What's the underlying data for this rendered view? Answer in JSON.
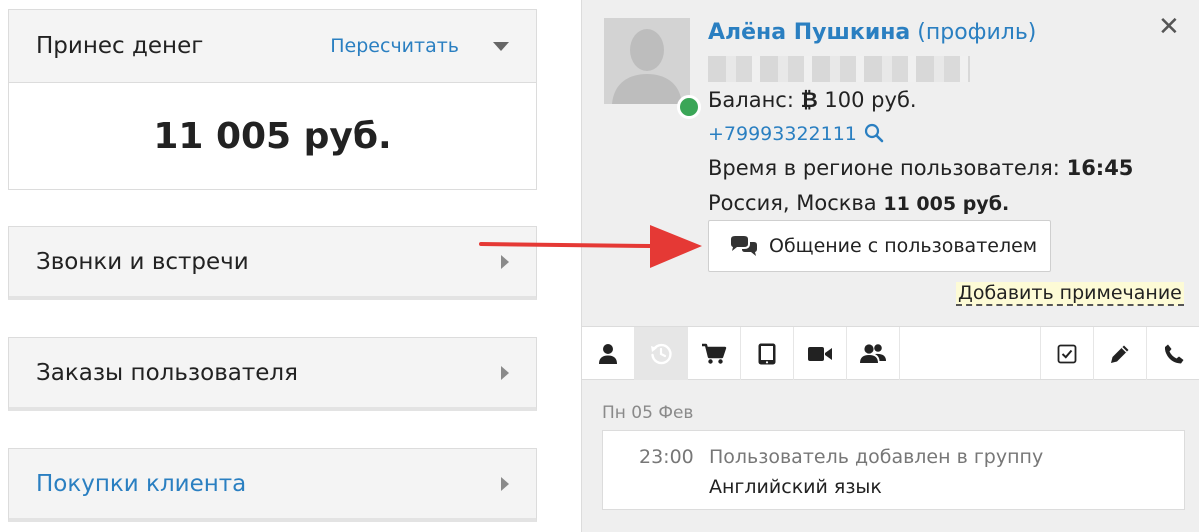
{
  "left": {
    "money_card": {
      "title": "Принес денег",
      "recalc_label": "Пересчитать",
      "amount": "11 005 руб."
    },
    "sections": [
      {
        "label": "Звонки и встречи"
      },
      {
        "label": "Заказы пользователя"
      },
      {
        "label": "Покупки клиента"
      }
    ]
  },
  "panel": {
    "close_icon": "close-icon",
    "user": {
      "name": "Алёна Пушкина",
      "profile_link": "(профиль)",
      "online_color": "#3aa657"
    },
    "balance": {
      "label": "Баланс:",
      "currency_icon": "bitcoin-icon",
      "value": "100 руб."
    },
    "phone": "+79993322111",
    "region_time": {
      "label": "Время в регионе пользователя:",
      "value": "16:45"
    },
    "location": {
      "text": "Россия, Москва",
      "amount": "11 005 руб."
    },
    "chat_button_label": "Общение с пользователем",
    "add_note_label": "Добавить примечание",
    "tabs": [
      {
        "icon": "user-icon",
        "active": false
      },
      {
        "icon": "history-icon",
        "active": true
      },
      {
        "icon": "cart-icon",
        "active": false
      },
      {
        "icon": "tablet-icon",
        "active": false
      },
      {
        "icon": "video-icon",
        "active": false
      },
      {
        "icon": "group-icon",
        "active": false
      },
      {
        "icon": "checkbox-icon",
        "active": false
      },
      {
        "icon": "pencil-icon",
        "active": false
      },
      {
        "icon": "phone-icon",
        "active": false
      }
    ],
    "timeline": {
      "date": "Пн 05 Фев",
      "events": [
        {
          "time": "23:00",
          "text": "Пользователь добавлен в группу",
          "detail": "Английский язык"
        }
      ]
    }
  },
  "colors": {
    "link": "#2a7fc1",
    "arrow": "#e53935",
    "note_bg": "#fdfbd6"
  }
}
